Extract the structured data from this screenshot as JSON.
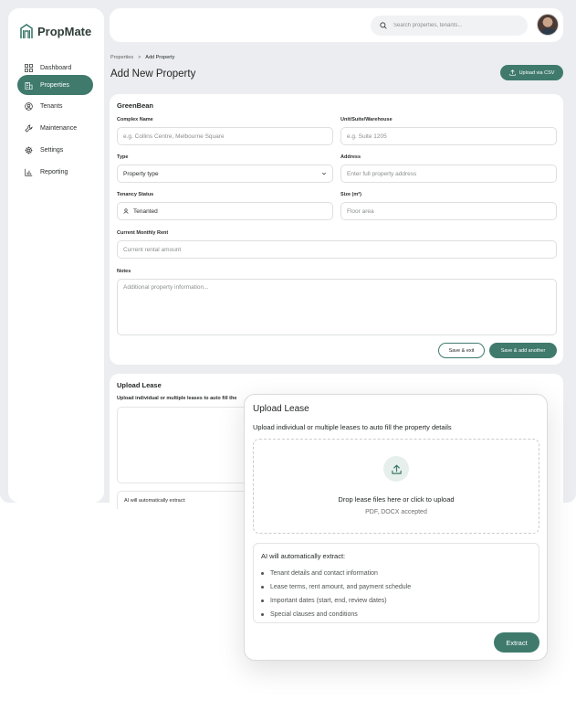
{
  "app": {
    "name": "PropMate",
    "brand_color": "#3f7a6d"
  },
  "sidebar": {
    "items": [
      {
        "label": "Dashboard",
        "icon": "grid-icon",
        "active": false
      },
      {
        "label": "Properties",
        "icon": "building-icon",
        "active": true
      },
      {
        "label": "Tenants",
        "icon": "user-circle-icon",
        "active": false
      },
      {
        "label": "Maintenance",
        "icon": "wrench-icon",
        "active": false
      },
      {
        "label": "Settings",
        "icon": "gear-icon",
        "active": false
      },
      {
        "label": "Reporting",
        "icon": "bar-chart-icon",
        "active": false
      }
    ]
  },
  "topbar": {
    "search_placeholder": "Search properties, tenants..."
  },
  "page": {
    "breadcrumb": {
      "parent": "Properties",
      "separator": ">",
      "current": "Add Property"
    },
    "title": "Add New Property",
    "upload_csv_label": "Upload via CSV"
  },
  "form": {
    "section_title": "GreenBean",
    "complex_name": {
      "label": "Complex Name",
      "placeholder": "e.g. Collins Centre, Melbourne Square"
    },
    "unit": {
      "label": "Unit/Suite/Warehouse",
      "placeholder": "e.g. Suite 1205"
    },
    "type": {
      "label": "Type",
      "value": "Property type"
    },
    "address": {
      "label": "Address",
      "placeholder": "Enter full property address"
    },
    "tenancy_status": {
      "label": "Tenancy Status",
      "value": "Tenanted"
    },
    "size": {
      "label": "Size (m²)",
      "placeholder": "Floor area"
    },
    "rent": {
      "label": "Current Monthly Rent",
      "placeholder": "Current rental amount"
    },
    "notes": {
      "label": "Notes",
      "placeholder": "Additional property information..."
    },
    "save_exit_label": "Save & exit",
    "save_add_label": "Save & add another"
  },
  "upload_section": {
    "title": "Upload Lease",
    "subtitle": "Upload individual or multiple leases to auto fill the",
    "extract_title": "AI will automatically extract:"
  },
  "modal": {
    "title": "Upload Lease",
    "subtitle": "Upload individual or multiple leases to auto fill the property details",
    "drop_text": "Drop lease files here or click to upload",
    "drop_hint": "PDF, DOCX accepted",
    "extract_title": "AI will automatically extract:",
    "extract_items": [
      "Tenant details and contact information",
      "Lease terms, rent amount, and payment schedule",
      "Important dates (start, end, review dates)",
      "Special clauses and conditions"
    ],
    "extract_button": "Extract"
  }
}
